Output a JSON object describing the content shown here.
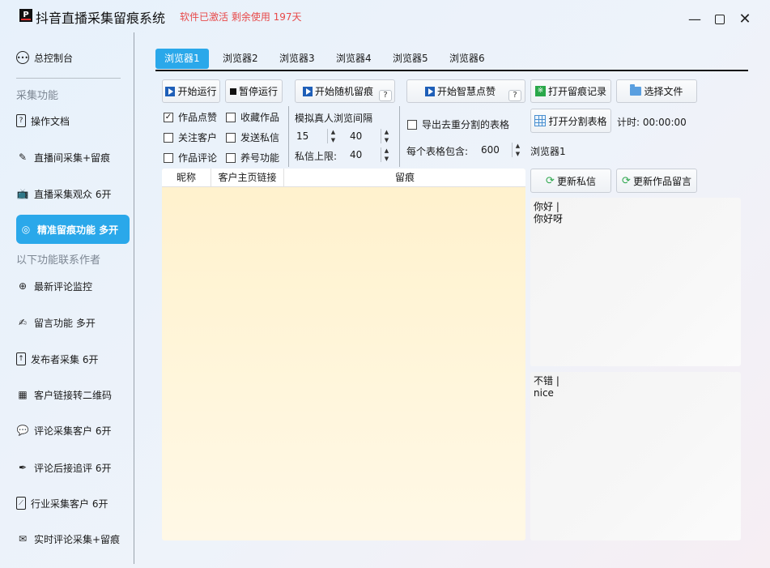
{
  "window": {
    "title": "抖音直播采集留痕系统",
    "status": "软件已激活 剩余使用 197天",
    "logo_text": "P"
  },
  "sidebar": {
    "console": "总控制台",
    "section1": "采集功能",
    "section2": "以下功能联系作者",
    "items": [
      {
        "label": "操作文档",
        "icon": "document-help-icon"
      },
      {
        "label": "直播间采集+留痕",
        "icon": "pen-icon"
      },
      {
        "label": "直播采集观众 6开",
        "icon": "tv-icon"
      },
      {
        "label": "精准留痕功能 多开",
        "icon": "target-icon"
      },
      {
        "label": "最新评论监控",
        "icon": "crosshair-icon"
      },
      {
        "label": "留言功能 多开",
        "icon": "edit-icon"
      },
      {
        "label": "发布者采集 6开",
        "icon": "upload-icon"
      },
      {
        "label": "客户链接转二维码",
        "icon": "qrcode-icon"
      },
      {
        "label": "评论采集客户 6开",
        "icon": "chat-icon"
      },
      {
        "label": "评论后接追评 6开",
        "icon": "pen-line-icon"
      },
      {
        "label": "行业采集客户 6开",
        "icon": "chart-icon"
      },
      {
        "label": "实时评论采集+留痕",
        "icon": "comment-edit-icon"
      }
    ]
  },
  "tabs": [
    "浏览器1",
    "浏览器2",
    "浏览器3",
    "浏览器4",
    "浏览器5",
    "浏览器6"
  ],
  "toolbar": {
    "start": "开始运行",
    "pause": "暂停运行",
    "random": "开始随机留痕",
    "smart_like": "开始智慧点赞",
    "open_record": "打开留痕记录",
    "choose_file": "选择文件",
    "open_split": "打开分割表格",
    "timer": "计时: 00:00:00",
    "help": "?"
  },
  "options": {
    "like_works": "作品点赞",
    "collect_works": "收藏作品",
    "follow": "关注客户",
    "send_dm": "发送私信",
    "comment_works": "作品评论",
    "nurture": "养号功能",
    "interval_label": "模拟真人浏览间隔",
    "interval_min": "15",
    "interval_max": "40",
    "dm_limit_label": "私信上限:",
    "dm_limit": "40",
    "export_dedup": "导出去重分割的表格",
    "per_table_label": "每个表格包含:",
    "per_table": "600",
    "browser_label": "浏览器1",
    "checked": {
      "like_works": true,
      "collect_works": false,
      "follow": false,
      "send_dm": false,
      "comment_works": false,
      "nurture": false,
      "export_dedup": false
    }
  },
  "table": {
    "columns": [
      "昵称",
      "客户主页链接",
      "留痕"
    ]
  },
  "panels": {
    "update_dm": "更新私信",
    "update_comment": "更新作品留言",
    "dm_lines": [
      "你好  |",
      "你好呀"
    ],
    "comment_lines": [
      "不错  |",
      "nice"
    ]
  },
  "colors": {
    "accent": "#2aa8ea",
    "status": "#e84a4a"
  }
}
